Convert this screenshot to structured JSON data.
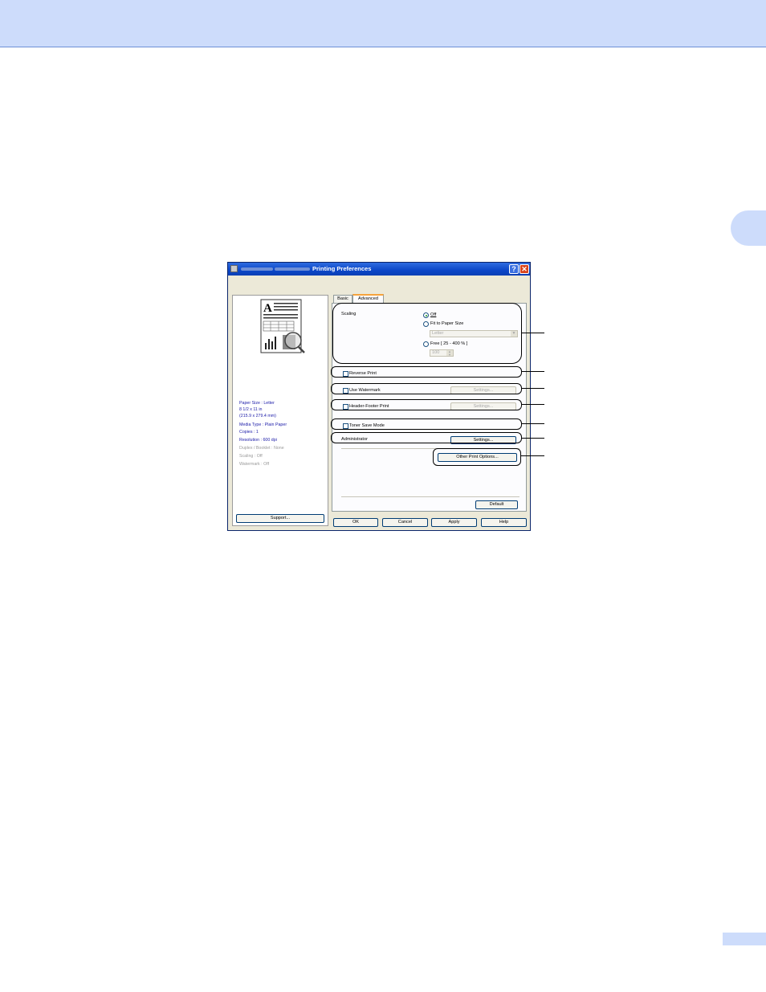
{
  "dialog": {
    "title": "Printing Preferences",
    "tabs": [
      {
        "label": "Basic",
        "active": false
      },
      {
        "label": "Advanced",
        "active": true
      }
    ],
    "help_icon": "question-icon",
    "close_icon": "close-icon"
  },
  "left_panel": {
    "info_lines": [
      {
        "text": "Paper Size : Letter",
        "enabled": true
      },
      {
        "text": "8 1/2 x 11 in",
        "enabled": true
      },
      {
        "text": "(215.9 x 279.4 mm)",
        "enabled": true
      },
      {
        "text": "Media Type : Plain Paper",
        "enabled": true
      },
      {
        "text": "Copies : 1",
        "enabled": true
      },
      {
        "text": "Resolution : 600 dpi",
        "enabled": true
      },
      {
        "text": "Duplex / Booklet : None",
        "enabled": false
      },
      {
        "text": "Scaling : Off",
        "enabled": false
      },
      {
        "text": "Watermark : Off",
        "enabled": false
      }
    ],
    "support_button": "Support..."
  },
  "advanced": {
    "scaling_label": "Scaling",
    "scaling_options": [
      {
        "label": "Off",
        "selected": true
      },
      {
        "label": "Fit to Paper Size",
        "selected": false
      },
      {
        "label": "Free [ 25 - 400 % ]",
        "selected": false
      }
    ],
    "paper_size_select": "Letter",
    "free_percent": "100",
    "reverse_print": "Reverse Print",
    "use_watermark": "Use Watermark",
    "watermark_settings": "Settings...",
    "header_footer": "Header-Footer Print",
    "header_footer_settings": "Settings...",
    "toner_save": "Toner Save Mode",
    "administrator": "Administrator",
    "administrator_settings": "Settings...",
    "other_print_options": "Other Print Options...",
    "default_button": "Default"
  },
  "footer_buttons": {
    "ok": "OK",
    "cancel": "Cancel",
    "apply": "Apply",
    "help": "Help"
  }
}
